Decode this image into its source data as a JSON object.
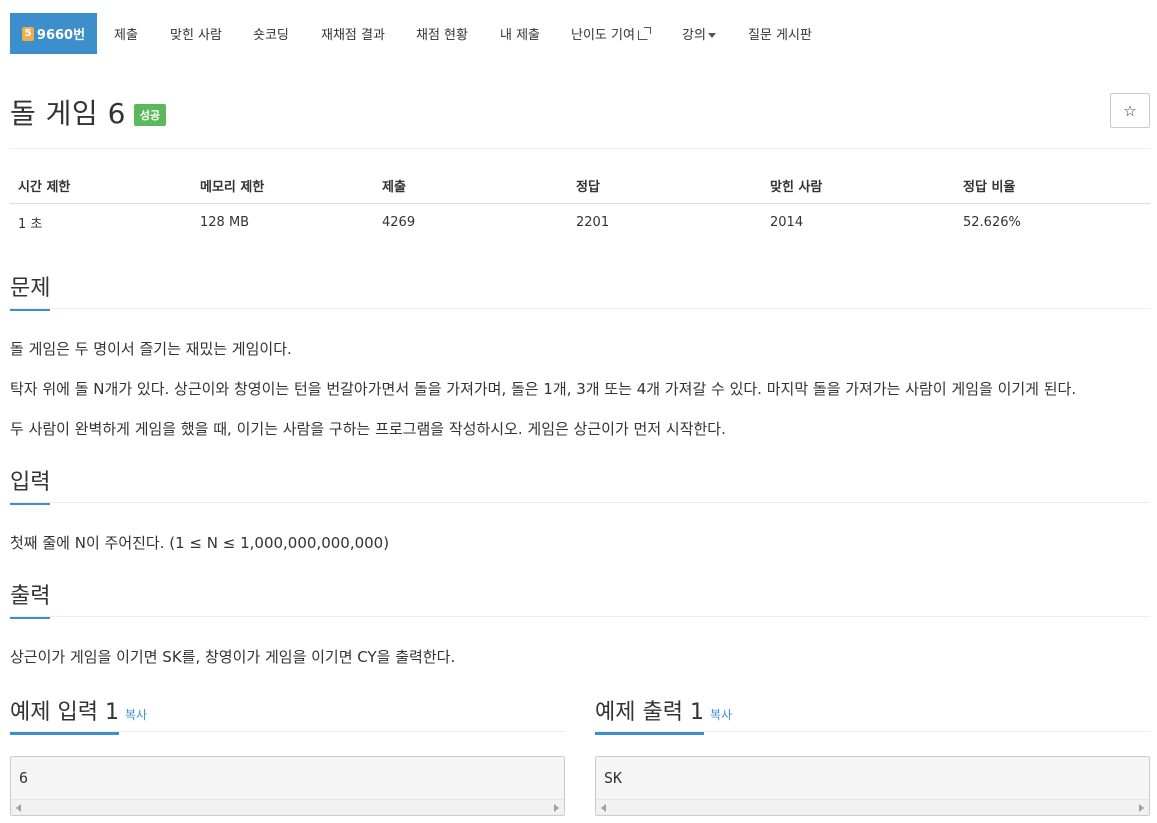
{
  "nav": {
    "problem_id": "9660번",
    "badge": "5",
    "items": [
      "제출",
      "맞힌 사람",
      "숏코딩",
      "재채점 결과",
      "채점 현황",
      "내 제출",
      "난이도 기여",
      "강의",
      "질문 게시판"
    ]
  },
  "problem": {
    "title": "돌 게임 6",
    "status": "성공",
    "star": "☆"
  },
  "info": {
    "headers": [
      "시간 제한",
      "메모리 제한",
      "제출",
      "정답",
      "맞힌 사람",
      "정답 비율"
    ],
    "values": [
      "1 초",
      "128 MB",
      "4269",
      "2201",
      "2014",
      "52.626%"
    ]
  },
  "sections": {
    "problem_title": "문제",
    "problem_body": [
      "돌 게임은 두 명이서 즐기는 재밌는 게임이다.",
      "탁자 위에 돌 N개가 있다. 상근이와 창영이는 턴을 번갈아가면서 돌을 가져가며, 돌은 1개, 3개 또는 4개 가져갈 수 있다. 마지막 돌을 가져가는 사람이 게임을 이기게 된다.",
      "두 사람이 완벽하게 게임을 했을 때, 이기는 사람을 구하는 프로그램을 작성하시오. 게임은 상근이가 먼저 시작한다."
    ],
    "input_title": "입력",
    "input_body": "첫째 줄에 N이 주어진다. (1 ≤ N ≤ 1,000,000,000,000)",
    "output_title": "출력",
    "output_body": "상근이가 게임을 이기면 SK를, 창영이가 게임을 이기면 CY을 출력한다."
  },
  "samples": {
    "input_title": "예제 입력 1",
    "output_title": "예제 출력 1",
    "copy_label": "복사",
    "input_value": "6",
    "output_value": "SK"
  }
}
